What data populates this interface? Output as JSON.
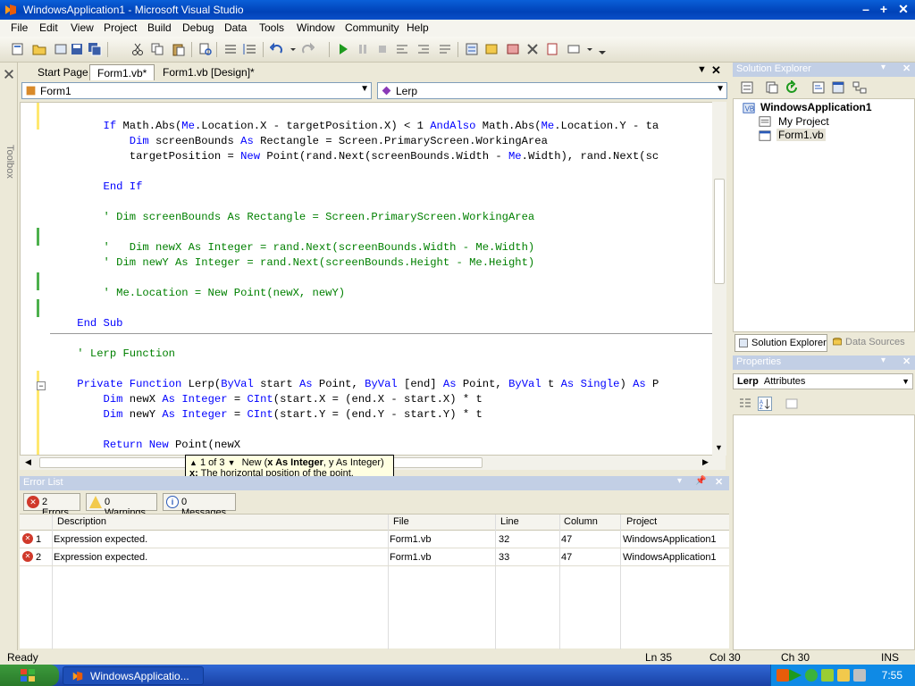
{
  "window": {
    "title": "WindowsApplication1 - Microsoft Visual Studio"
  },
  "menu": [
    "File",
    "Edit",
    "View",
    "Project",
    "Build",
    "Debug",
    "Data",
    "Tools",
    "Window",
    "Community",
    "Help"
  ],
  "toolbox": {
    "label": "Toolbox"
  },
  "tabs": [
    {
      "label": "Start Page",
      "active": false
    },
    {
      "label": "Form1.vb*",
      "active": true
    },
    {
      "label": "Form1.vb [Design]*",
      "active": false
    }
  ],
  "editor": {
    "class_combo": "Form1",
    "member_combo": "Lerp",
    "lines": [
      {
        "indent": "        ",
        "tokens": [
          [
            "kw",
            "If "
          ],
          [
            "tx",
            "Math.Abs("
          ],
          [
            "kw",
            "Me"
          ],
          [
            "tx",
            ".Location.X - targetPosition.X) < 1 "
          ],
          [
            "kw",
            "AndAlso"
          ],
          [
            "tx",
            " Math.Abs("
          ],
          [
            "kw",
            "Me"
          ],
          [
            "tx",
            ".Location.Y - ta"
          ]
        ]
      },
      {
        "indent": "            ",
        "tokens": [
          [
            "kw",
            "Dim"
          ],
          [
            "tx",
            " screenBounds "
          ],
          [
            "kw",
            "As"
          ],
          [
            "tx",
            " Rectangle = Screen.PrimaryScreen.WorkingArea"
          ]
        ]
      },
      {
        "indent": "            ",
        "tokens": [
          [
            "tx",
            "targetPosition = "
          ],
          [
            "kw",
            "New"
          ],
          [
            "tx",
            " Point(rand.Next(screenBounds.Width - "
          ],
          [
            "kw",
            "Me"
          ],
          [
            "tx",
            ".Width), rand.Next(sc"
          ]
        ]
      },
      {
        "indent": "",
        "tokens": []
      },
      {
        "indent": "        ",
        "tokens": [
          [
            "kw",
            "End If"
          ]
        ]
      },
      {
        "indent": "",
        "tokens": []
      },
      {
        "indent": "        ",
        "tokens": [
          [
            "cm",
            "' Dim screenBounds As Rectangle = Screen.PrimaryScreen.WorkingArea"
          ]
        ]
      },
      {
        "indent": "",
        "tokens": []
      },
      {
        "indent": "        ",
        "tokens": [
          [
            "cm",
            "'   Dim newX As Integer = rand.Next(screenBounds.Width - Me.Width)"
          ]
        ]
      },
      {
        "indent": "        ",
        "tokens": [
          [
            "cm",
            "' Dim newY As Integer = rand.Next(screenBounds.Height - Me.Height)"
          ]
        ]
      },
      {
        "indent": "",
        "tokens": []
      },
      {
        "indent": "        ",
        "tokens": [
          [
            "cm",
            "' Me.Location = New Point(newX, newY)"
          ]
        ]
      },
      {
        "indent": "",
        "tokens": []
      },
      {
        "indent": "    ",
        "tokens": [
          [
            "kw",
            "End Sub"
          ]
        ]
      },
      {
        "indent": "",
        "tokens": []
      },
      {
        "indent": "    ",
        "tokens": [
          [
            "cm",
            "' Lerp Function"
          ]
        ]
      },
      {
        "indent": "",
        "tokens": []
      },
      {
        "indent": "    ",
        "tokens": [
          [
            "kw",
            "Private Function"
          ],
          [
            "tx",
            " Lerp("
          ],
          [
            "kw",
            "ByVal"
          ],
          [
            "tx",
            " start "
          ],
          [
            "kw",
            "As"
          ],
          [
            "tx",
            " Point, "
          ],
          [
            "kw",
            "ByVal"
          ],
          [
            "tx",
            " [end] "
          ],
          [
            "kw",
            "As"
          ],
          [
            "tx",
            " Point, "
          ],
          [
            "kw",
            "ByVal"
          ],
          [
            "tx",
            " t "
          ],
          [
            "kw",
            "As"
          ],
          [
            "tx",
            " "
          ],
          [
            "kw",
            "Single"
          ],
          [
            "tx",
            ") "
          ],
          [
            "kw",
            "As"
          ],
          [
            "tx",
            " P"
          ]
        ]
      },
      {
        "indent": "        ",
        "tokens": [
          [
            "kw",
            "Dim"
          ],
          [
            "tx",
            " newX "
          ],
          [
            "kw",
            "As"
          ],
          [
            "tx",
            " "
          ],
          [
            "kw",
            "Integer"
          ],
          [
            "tx",
            " = "
          ],
          [
            "kw",
            "CInt"
          ],
          [
            "tx",
            "(start.X = (end.X - start.X) * t"
          ]
        ]
      },
      {
        "indent": "        ",
        "tokens": [
          [
            "kw",
            "Dim"
          ],
          [
            "tx",
            " newY "
          ],
          [
            "kw",
            "As"
          ],
          [
            "tx",
            " "
          ],
          [
            "kw",
            "Integer"
          ],
          [
            "tx",
            " = "
          ],
          [
            "kw",
            "CInt"
          ],
          [
            "tx",
            "(start.Y = (end.Y - start.Y) * t"
          ]
        ]
      },
      {
        "indent": "",
        "tokens": []
      },
      {
        "indent": "        ",
        "tokens": [
          [
            "kw",
            "Return New"
          ],
          [
            "tx",
            " Point(newX"
          ]
        ]
      }
    ]
  },
  "tooltip": {
    "counter": "1 of 3",
    "signature_prefix": "New (",
    "signature_bold": "x As Integer",
    "signature_suffix": ", y As Integer)",
    "param": "x:",
    "description": "The horizontal position of the point."
  },
  "error_list": {
    "title": "Error List",
    "buttons": [
      "2 Errors",
      "0 Warnings",
      "0 Messages"
    ],
    "columns": [
      "Description",
      "File",
      "Line",
      "Column",
      "Project"
    ],
    "rows": [
      {
        "num": "1",
        "description": "Expression expected.",
        "file": "Form1.vb",
        "line": "32",
        "column": "47",
        "project": "WindowsApplication1"
      },
      {
        "num": "2",
        "description": "Expression expected.",
        "file": "Form1.vb",
        "line": "33",
        "column": "47",
        "project": "WindowsApplication1"
      }
    ]
  },
  "solution_explorer": {
    "title": "Solution Explorer",
    "root": "WindowsApplication1",
    "items": [
      "My Project",
      "Form1.vb"
    ],
    "tabs": [
      "Solution Explorer",
      "Data Sources"
    ]
  },
  "properties": {
    "title": "Properties",
    "object_name": "Lerp",
    "object_type": "Attributes"
  },
  "status": {
    "text": "Ready",
    "ln": "Ln 35",
    "col": "Col 30",
    "ch": "Ch 30",
    "mode": "INS"
  },
  "taskbar": {
    "item": "WindowsApplicatio...",
    "clock": "7:55"
  },
  "colors": {
    "keyword": "#0000ff",
    "comment": "#008000",
    "titlebar": "#0a5fd8"
  }
}
